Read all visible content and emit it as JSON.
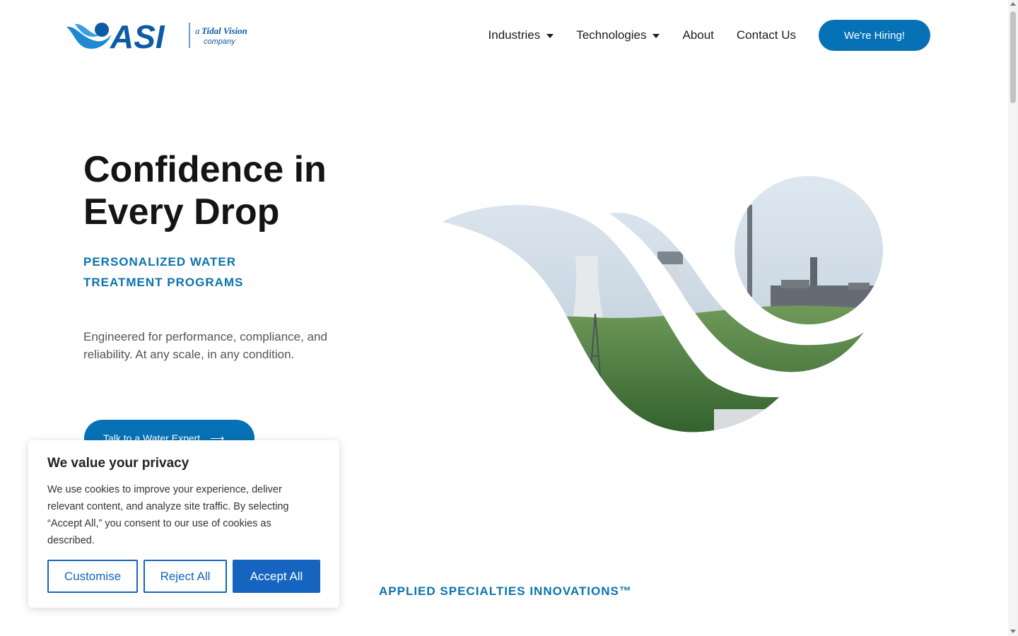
{
  "brand": {
    "name": "ASI",
    "tagline_a": "a",
    "tagline_brand": "Tidal Vision",
    "tagline_company": "company",
    "primary_color": "#0672b5",
    "accent_color": "#0a73ad"
  },
  "nav": {
    "items": [
      {
        "label": "Industries",
        "has_dropdown": true
      },
      {
        "label": "Technologies",
        "has_dropdown": true
      },
      {
        "label": "About",
        "has_dropdown": false
      },
      {
        "label": "Contact Us",
        "has_dropdown": false
      }
    ],
    "hire_label": "We're Hiring!"
  },
  "hero": {
    "title_line1": "Confidence in",
    "title_line2": "Every Drop",
    "subtitle_line1": "PERSONALIZED WATER",
    "subtitle_line2": "TREATMENT PROGRAMS",
    "description": "Engineered for performance, compliance, and reliability. At any scale, in any condition.",
    "cta_label": "Talk to a Water Expert",
    "cta_icon": "arrow-right-icon"
  },
  "section": {
    "kicker": "APPLIED SPECIALTIES INNOVATIONS™"
  },
  "cookie": {
    "title": "We value your privacy",
    "text": "We use cookies to improve your experience, deliver relevant content, and analyze site traffic. By selecting “Accept All,” you consent to our use of cookies as described.",
    "customise_label": "Customise",
    "reject_label": "Reject All",
    "accept_label": "Accept All",
    "button_color": "#1565c0"
  }
}
